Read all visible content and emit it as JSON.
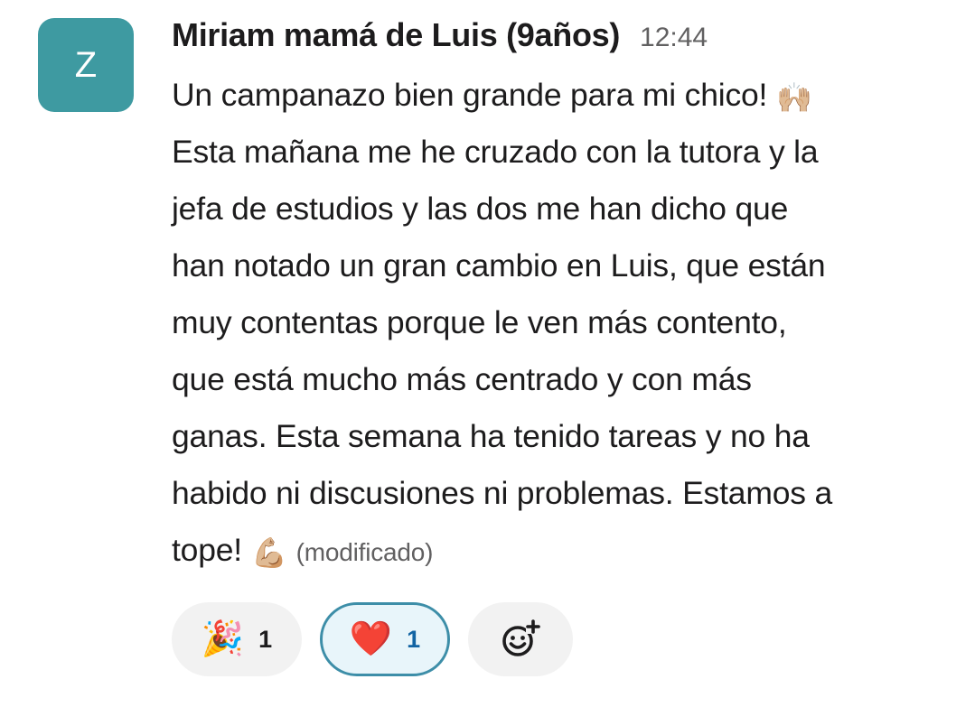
{
  "message": {
    "avatar_letter": "Z",
    "sender": "Miriam mamá de Luis (9años)",
    "timestamp": "12:44",
    "lines": [
      "Un campanazo bien grande para mi chico!",
      "Esta mañana me he cruzado con la tutora y la",
      "jefa de estudios y las dos me han dicho que",
      "han notado un gran cambio en Luis, que están",
      "muy contentas porque le ven más contento,",
      "que está mucho más centrado y con más",
      "ganas. Esta semana ha tenido tareas y no ha",
      "habido ni discusiones ni problemas. Estamos a",
      "tope!"
    ],
    "emoji_raised_hands": "🙌🏼",
    "emoji_flexed_biceps": "💪🏼",
    "edited_label": "(modificado)"
  },
  "reactions": [
    {
      "emoji": "🎉",
      "count": "1",
      "selected": false
    },
    {
      "emoji": "❤️",
      "count": "1",
      "selected": true
    }
  ],
  "add_reaction_icon": "add-reaction-icon",
  "colors": {
    "avatar_bg": "#3e9aa1",
    "selected_reaction_border": "#3d8ea8",
    "selected_reaction_bg": "#e8f5fa",
    "reaction_bg": "#f2f2f2",
    "timestamp": "#616061"
  }
}
